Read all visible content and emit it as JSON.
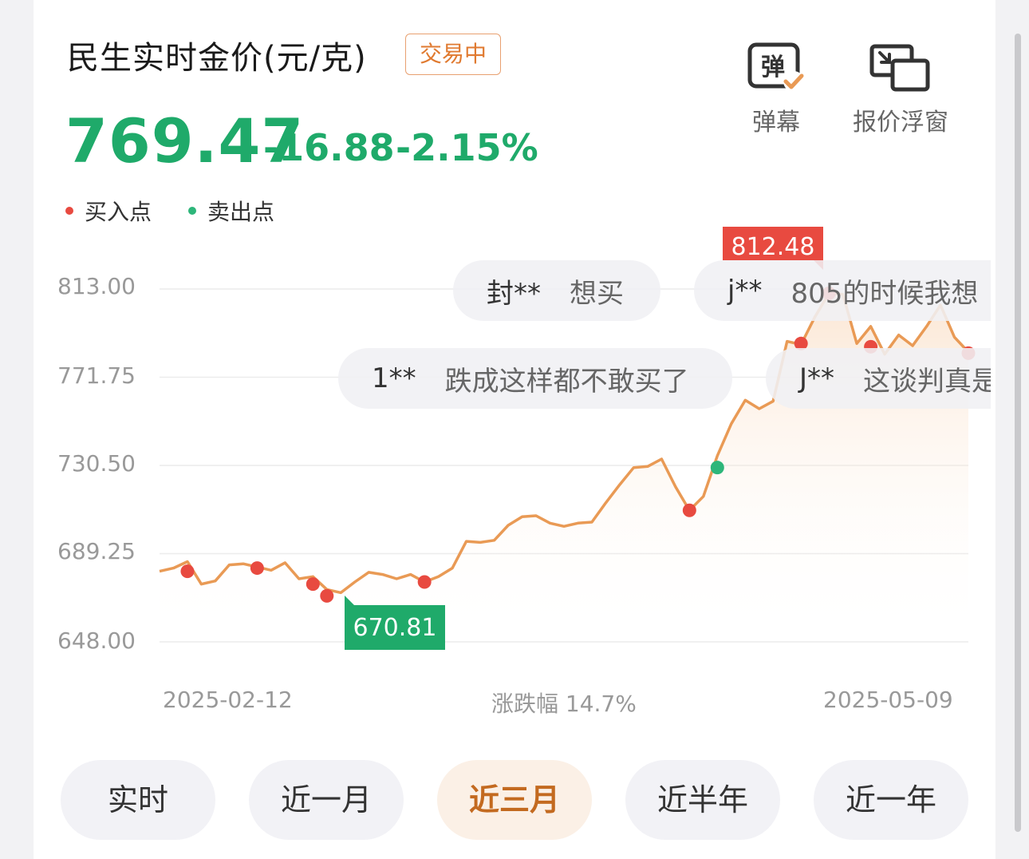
{
  "header": {
    "title": "民生实时金价(元/克)",
    "status": "交易中",
    "price": "769.47",
    "change": "-16.88",
    "change_pct": "-2.15%"
  },
  "legend": {
    "buy": "买入点",
    "sell": "卖出点"
  },
  "tools": [
    {
      "label": "弹幕",
      "icon": "danmaku-icon"
    },
    {
      "label": "报价浮窗",
      "icon": "floating-window-icon"
    }
  ],
  "chart_data": {
    "type": "line",
    "y_ticks": [
      "813.00",
      "771.75",
      "730.50",
      "689.25",
      "648.00"
    ],
    "ylim": [
      648.0,
      813.0
    ],
    "x_start_label": "2025-02-12",
    "x_end_label": "2025-05-09",
    "range_text": "涨跌幅 14.7%",
    "max_label": "812.48",
    "min_label": "670.81",
    "series": [
      {
        "values": [
          681.0,
          682.5,
          685.5,
          675.0,
          676.5,
          684.0,
          684.5,
          683.0,
          681.5,
          685.0,
          677.5,
          678.5,
          672.5,
          671.0,
          676.0,
          680.5,
          679.5,
          677.5,
          679.5,
          676.0,
          678.5,
          682.5,
          695.0,
          694.5,
          695.5,
          702.5,
          706.5,
          707.0,
          703.5,
          702.0,
          703.5,
          704.0,
          713.0,
          721.5,
          729.5,
          730.0,
          733.5,
          720.5,
          709.5,
          716.0,
          735.0,
          750.0,
          761.0,
          757.0,
          760.5,
          788.5,
          787.0,
          800.0,
          811.0,
          810.5,
          787.5,
          795.5,
          782.5,
          791.5,
          786.5,
          795.5,
          805.5,
          790.5,
          783.5
        ]
      }
    ],
    "buy_points": [
      {
        "index": 2,
        "value": 681.0
      },
      {
        "index": 7,
        "value": 682.5
      },
      {
        "index": 11,
        "value": 675.0
      },
      {
        "index": 12,
        "value": 669.5
      },
      {
        "index": 19,
        "value": 676.0
      },
      {
        "index": 38,
        "value": 709.5
      },
      {
        "index": 46,
        "value": 787.5
      },
      {
        "index": 48,
        "value": 811.0
      },
      {
        "index": 51,
        "value": 786.0
      },
      {
        "index": 58,
        "value": 783.0
      }
    ],
    "sell_points": [
      {
        "index": 40,
        "value": 729.5
      }
    ],
    "colors": {
      "line": "#e99a55",
      "buy": "#e84a40",
      "sell": "#2db67a",
      "grid": "#ececec"
    }
  },
  "danmaku": [
    {
      "user": "封**",
      "msg": "想买"
    },
    {
      "user": "j**",
      "msg": "805的时候我想"
    },
    {
      "user": "1**",
      "msg": "跌成这样都不敢买了"
    },
    {
      "user": "J**",
      "msg": "这谈判真是"
    }
  ],
  "tabs": [
    "实时",
    "近一月",
    "近三月",
    "近半年",
    "近一年"
  ],
  "active_tab": "近三月"
}
